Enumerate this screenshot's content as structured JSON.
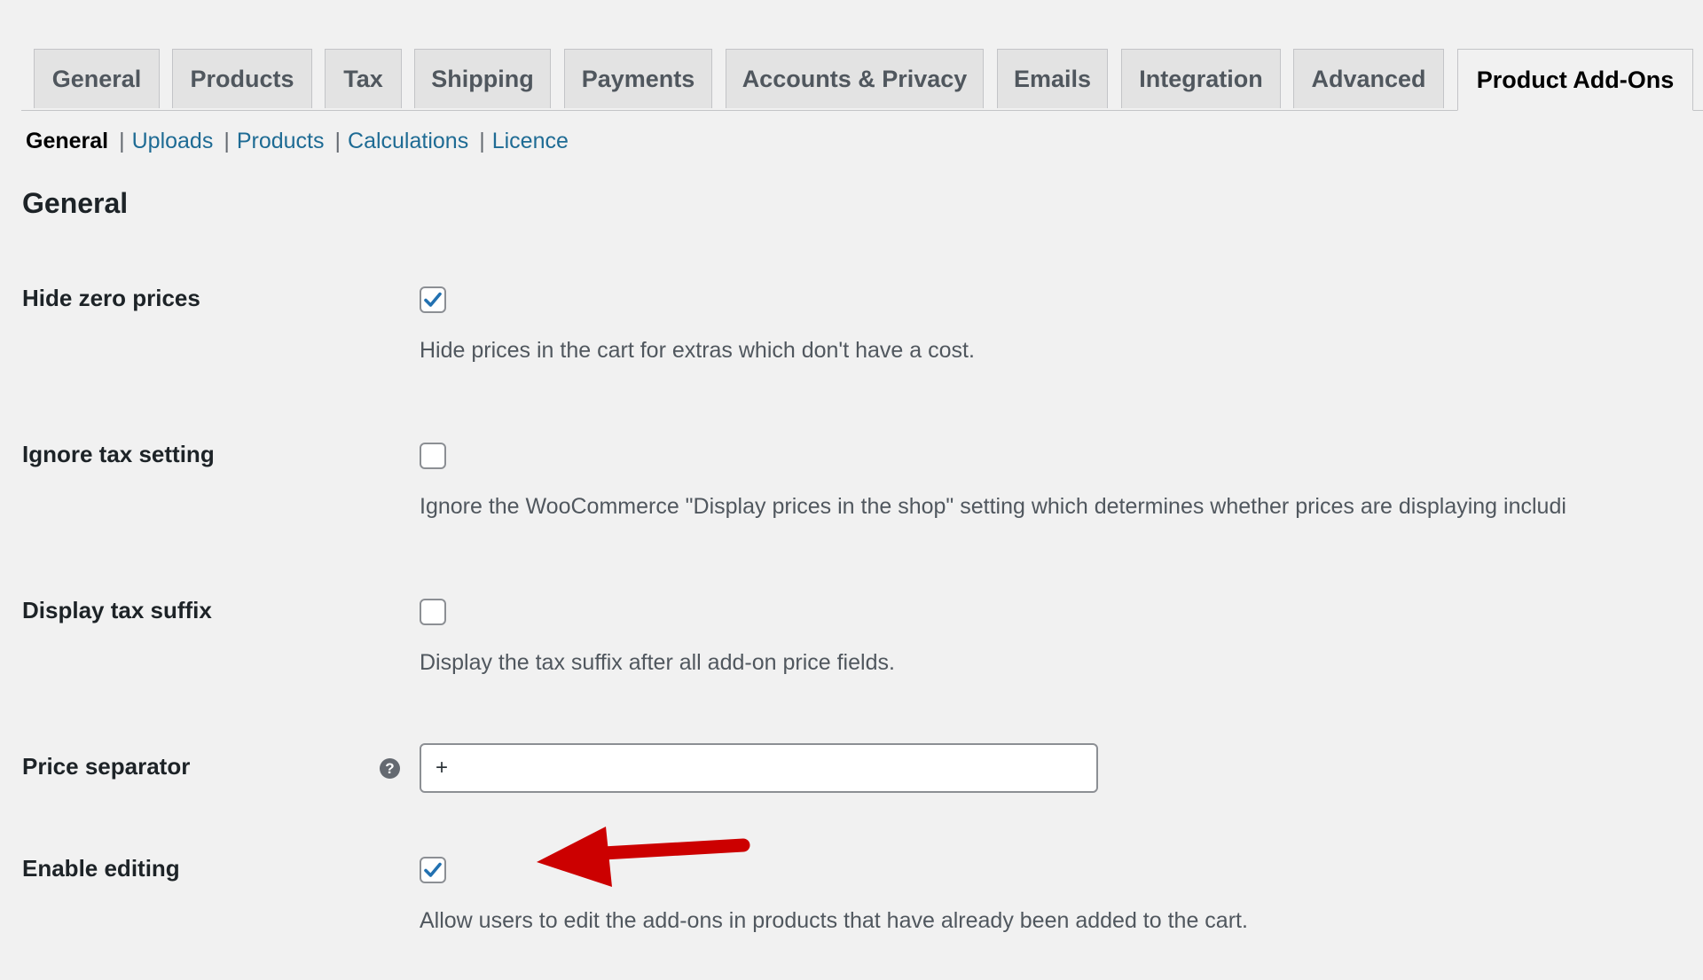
{
  "tabs": [
    {
      "label": "General",
      "active": false
    },
    {
      "label": "Products",
      "active": false
    },
    {
      "label": "Tax",
      "active": false
    },
    {
      "label": "Shipping",
      "active": false
    },
    {
      "label": "Payments",
      "active": false
    },
    {
      "label": "Accounts & Privacy",
      "active": false
    },
    {
      "label": "Emails",
      "active": false
    },
    {
      "label": "Integration",
      "active": false
    },
    {
      "label": "Advanced",
      "active": false
    },
    {
      "label": "Product Add-Ons",
      "active": true
    }
  ],
  "subnav": {
    "current": "General",
    "separator": "|",
    "links": [
      "Uploads",
      "Products",
      "Calculations",
      "Licence"
    ]
  },
  "section": {
    "title": "General"
  },
  "settings": {
    "hide_zero_prices": {
      "label": "Hide zero prices",
      "checked": true,
      "description": "Hide prices in the cart for extras which don't have a cost."
    },
    "ignore_tax_setting": {
      "label": "Ignore tax setting",
      "checked": false,
      "description": "Ignore the WooCommerce \"Display prices in the shop\" setting which determines whether prices are displaying includi"
    },
    "display_tax_suffix": {
      "label": "Display tax suffix",
      "checked": false,
      "description": "Display the tax suffix after all add-on price fields."
    },
    "price_separator": {
      "label": "Price separator",
      "help_icon": "question-mark-icon",
      "help_glyph": "?",
      "value": "+"
    },
    "enable_editing": {
      "label": "Enable editing",
      "checked": true,
      "description": "Allow users to edit the add-ons in products that have already been added to the cart."
    }
  },
  "annotation": {
    "icon": "red-arrow-icon",
    "color": "#cc0000"
  },
  "colors": {
    "checkmark": "#2271b1",
    "link": "#1e6b94",
    "background": "#f1f1f1"
  }
}
